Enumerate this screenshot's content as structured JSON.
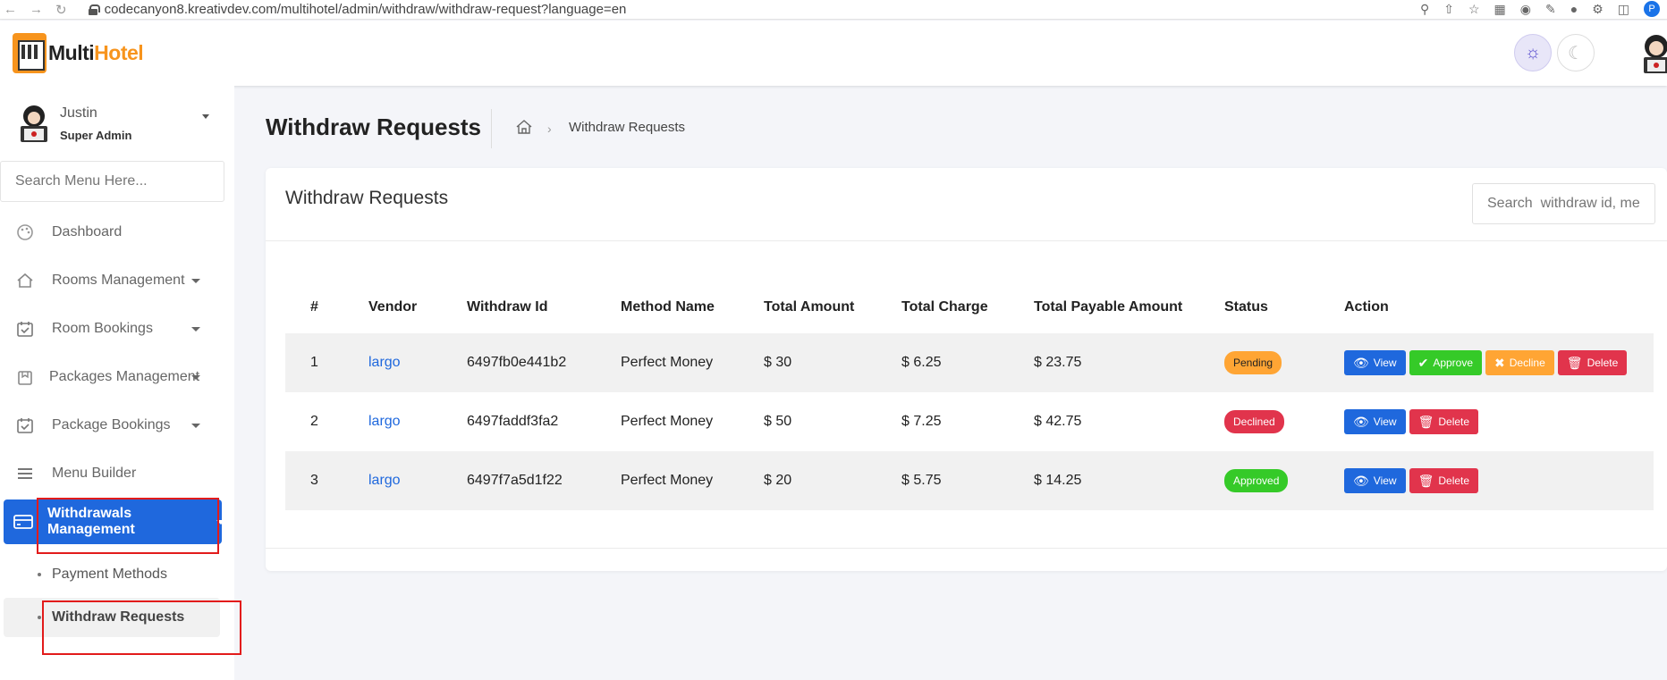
{
  "browser": {
    "url": "codecanyon8.kreativdev.com/multihotel/admin/withdraw/withdraw-request?language=en",
    "profile_initial": "P"
  },
  "header": {
    "logo_part1": "Multi",
    "logo_part2": "Hotel"
  },
  "sidebar": {
    "user_name": "Justin",
    "user_role": "Super Admin",
    "search_placeholder": "Search Menu Here...",
    "items": [
      {
        "label": "Dashboard",
        "icon": "palette-icon"
      },
      {
        "label": "Rooms Management",
        "icon": "home-icon"
      },
      {
        "label": "Room Bookings",
        "icon": "calendar-check-icon"
      },
      {
        "label": "Packages Management",
        "icon": "package-icon"
      },
      {
        "label": "Package Bookings",
        "icon": "calendar-check-icon"
      },
      {
        "label": "Menu Builder",
        "icon": "bars-icon"
      },
      {
        "label": "Withdrawals Management",
        "icon": "credit-card-icon"
      }
    ],
    "sub_items": [
      {
        "label": "Payment Methods"
      },
      {
        "label": "Withdraw Requests"
      }
    ]
  },
  "page": {
    "title": "Withdraw Requests",
    "breadcrumb": "Withdraw Requests"
  },
  "card": {
    "title": "Withdraw Requests",
    "search_placeholder": "Search  withdraw id, metl"
  },
  "table": {
    "headers": [
      "#",
      "Vendor",
      "Withdraw Id",
      "Method Name",
      "Total Amount",
      "Total Charge",
      "Total Payable Amount",
      "Status",
      "Action"
    ],
    "rows": [
      {
        "num": "1",
        "vendor": "largo",
        "withdraw_id": "6497fb0e441b2",
        "method": "Perfect Money",
        "total": "$ 30",
        "charge": "$ 6.25",
        "payable": "$ 23.75",
        "status": "Pending"
      },
      {
        "num": "2",
        "vendor": "largo",
        "withdraw_id": "6497faddf3fa2",
        "method": "Perfect Money",
        "total": "$ 50",
        "charge": "$ 7.25",
        "payable": "$ 42.75",
        "status": "Declined"
      },
      {
        "num": "3",
        "vendor": "largo",
        "withdraw_id": "6497f7a5d1f22",
        "method": "Perfect Money",
        "total": "$ 20",
        "charge": "$ 5.75",
        "payable": "$ 14.25",
        "status": "Approved"
      }
    ],
    "actions": {
      "view": "View",
      "approve": "Approve",
      "decline": "Decline",
      "delete": "Delete"
    }
  },
  "colors": {
    "primary": "#1f68dd",
    "success": "#35ca28",
    "warning": "#ffa534",
    "danger": "#e1344c",
    "brand": "#f7941d",
    "highlight_box": "#e21b1b"
  }
}
